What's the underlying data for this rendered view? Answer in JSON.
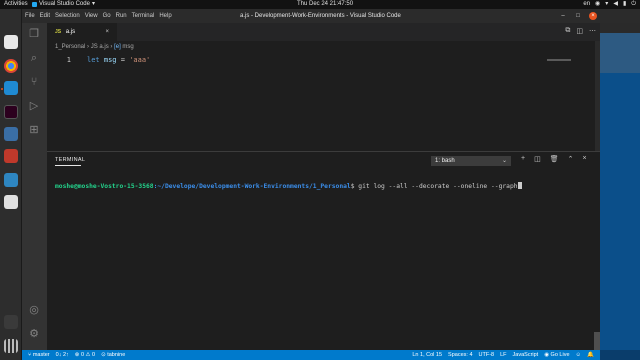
{
  "topbar": {
    "activities": "Activities",
    "app_name": "Visual Studio Code",
    "clock": "Thu Dec 24  21:47:50",
    "language": "en"
  },
  "window": {
    "title": "a.js - Development-Work-Environments - Visual Studio Code",
    "menu": [
      "File",
      "Edit",
      "Selection",
      "View",
      "Go",
      "Run",
      "Terminal",
      "Help"
    ]
  },
  "editor": {
    "tab_label": "a.js",
    "tab_lang": "JS",
    "breadcrumb": [
      "1_Personal",
      "JS a.js",
      "msg"
    ],
    "line_number": "1",
    "code": {
      "keyword": "let",
      "variable": "msg",
      "operator": "=",
      "string": "'aaa'"
    }
  },
  "panel": {
    "tab_label": "TERMINAL",
    "terminal_select": "1: bash",
    "prompt_user": "moshe@moshe-Vostro-15-3568",
    "prompt_path": ":~/Develope/Development-Work-Environments/1_Personal",
    "command": "$ git log --all --decorate --oneline --graph"
  },
  "statusbar": {
    "branch": "master",
    "sync": "0↓ 2↑",
    "errors": "0",
    "warnings": "0",
    "tabnine": "tabnine",
    "position": "Ln 1, Col 15",
    "spaces": "Spaces: 4",
    "encoding": "UTF-8",
    "eol": "LF",
    "language": "JavaScript",
    "golive": "Go Live"
  },
  "colors": {
    "statusbar": "#007acc",
    "activity_bar": "#333333",
    "editor_bg": "#1e1e1e",
    "prompt_user": "#23d18b",
    "prompt_path": "#3b8eea"
  },
  "icons": {
    "activity": [
      "files-icon",
      "search-icon",
      "source-control-icon",
      "run-debug-icon",
      "extensions-icon",
      "account-icon",
      "settings-gear-icon"
    ],
    "dock": [
      "files-app-icon",
      "chrome-icon",
      "vscode-icon",
      "terminal-icon",
      "app-icon",
      "image-viewer-icon",
      "system-monitor-icon",
      "software-icon",
      "trash-icon",
      "show-apps-icon"
    ]
  }
}
